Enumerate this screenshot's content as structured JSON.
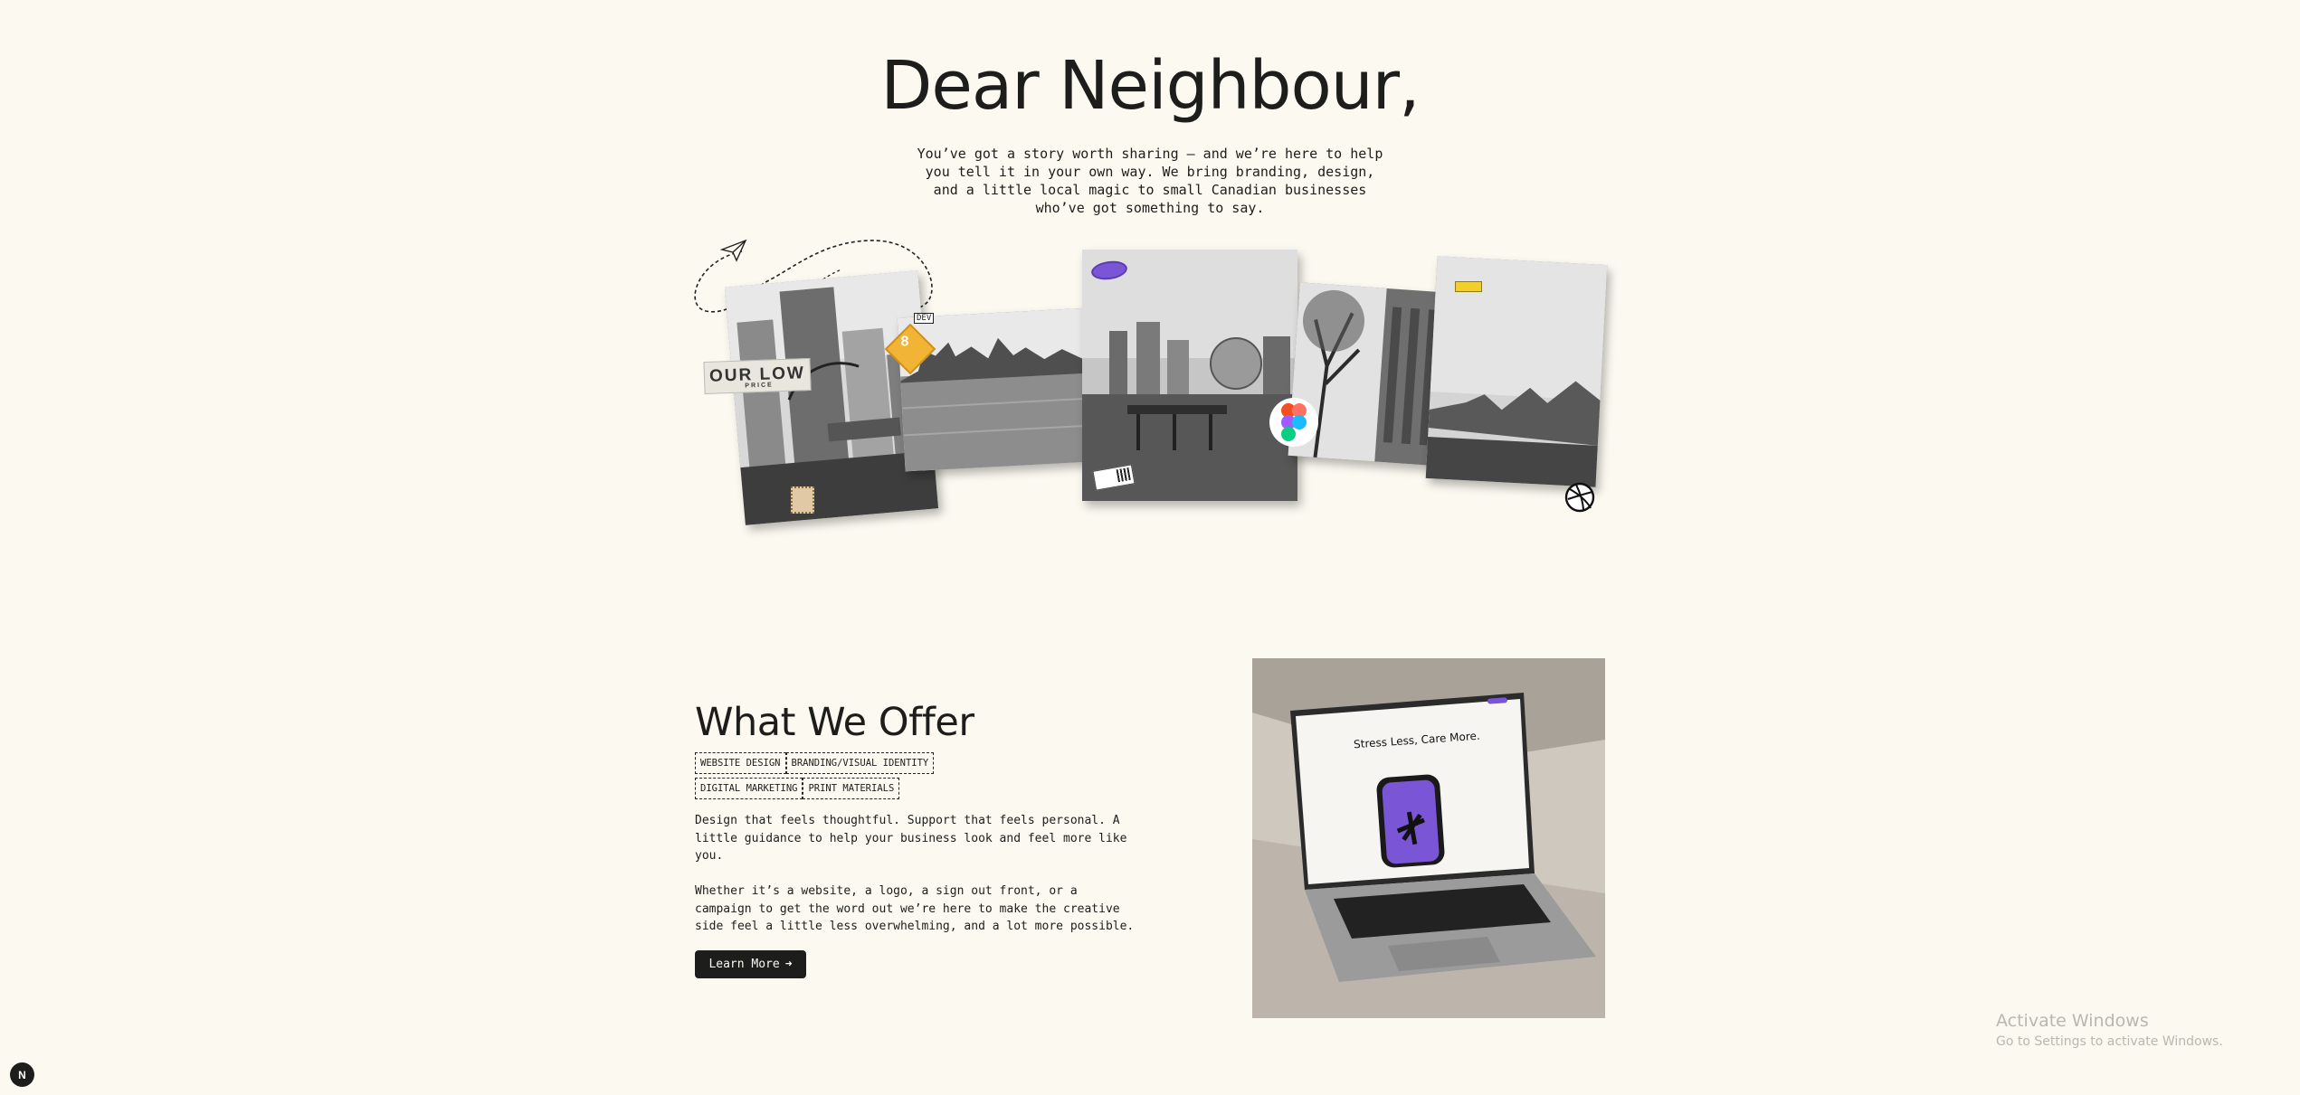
{
  "hero": {
    "title": "Dear Neighbour,",
    "text": "You’ve got a story worth sharing — and we’re here to help you tell it in your own way. We bring branding, design, and a little local magic to small Canadian businesses who’ve got something to say."
  },
  "collage": {
    "sticker_low": "OUR LOW",
    "sticker_low_small": "PRICE",
    "sticker_8": "8",
    "dev_chip": "DEV",
    "icons": [
      "paper-plane-icon",
      "figma-icon",
      "dribbble-icon"
    ]
  },
  "offer": {
    "title": "What We Offer",
    "tags": [
      "WEBSITE DESIGN",
      "BRANDING/VISUAL IDENTITY",
      "DIGITAL MARKETING",
      "PRINT MATERIALS"
    ],
    "paragraph_1": "Design that feels thoughtful. Support that feels personal. A little guidance to help your business look and feel more like you.",
    "paragraph_2": "Whether it’s a website, a logo, a sign out front, or a campaign to get the word out we’re here to make the creative side feel a little less overwhelming, and a lot more possible.",
    "button_label": "Learn More",
    "button_arrow": "➜"
  },
  "laptop_screen": {
    "headline": "Stress Less, Care More."
  },
  "watermark": {
    "line1": "Activate Windows",
    "line2": "Go to Settings to activate Windows."
  },
  "corner_badge": "N",
  "colors": {
    "background": "#fbf9f0",
    "text": "#1d1d1b",
    "accent_purple": "#7a56d6",
    "sticker_yellow": "#f1b435"
  }
}
